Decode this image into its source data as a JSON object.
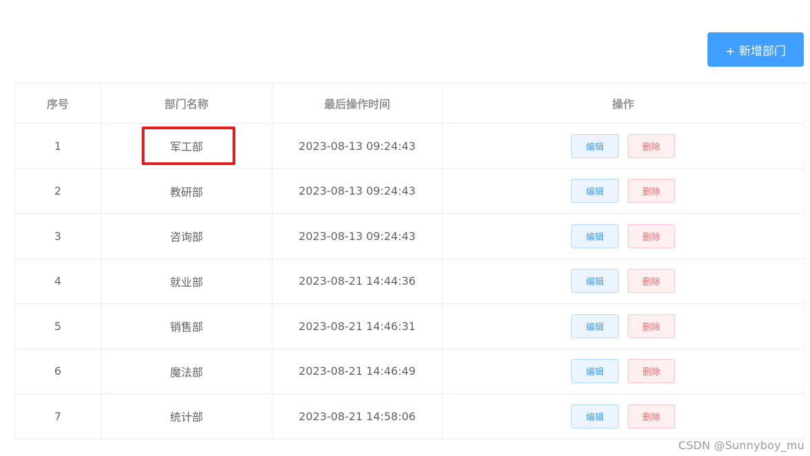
{
  "toolbar": {
    "add_label": "+ 新增部门"
  },
  "table": {
    "columns": [
      "序号",
      "部门名称",
      "最后操作时间",
      "操作"
    ],
    "rows": [
      {
        "index": "1",
        "name": "军工部",
        "time": "2023-08-13 09:24:43"
      },
      {
        "index": "2",
        "name": "教研部",
        "time": "2023-08-13 09:24:43"
      },
      {
        "index": "3",
        "name": "咨询部",
        "time": "2023-08-13 09:24:43"
      },
      {
        "index": "4",
        "name": "就业部",
        "time": "2023-08-21 14:44:36"
      },
      {
        "index": "5",
        "name": "销售部",
        "time": "2023-08-21 14:46:31"
      },
      {
        "index": "6",
        "name": "魔法部",
        "time": "2023-08-21 14:46:49"
      },
      {
        "index": "7",
        "name": "统计部",
        "time": "2023-08-21 14:58:06"
      }
    ],
    "edit_label": "编辑",
    "delete_label": "删除"
  },
  "watermark": "CSDN @Sunnyboy_mu",
  "colors": {
    "primary": "#409eff",
    "danger": "#f56c6c",
    "highlight": "#e01e1e"
  }
}
